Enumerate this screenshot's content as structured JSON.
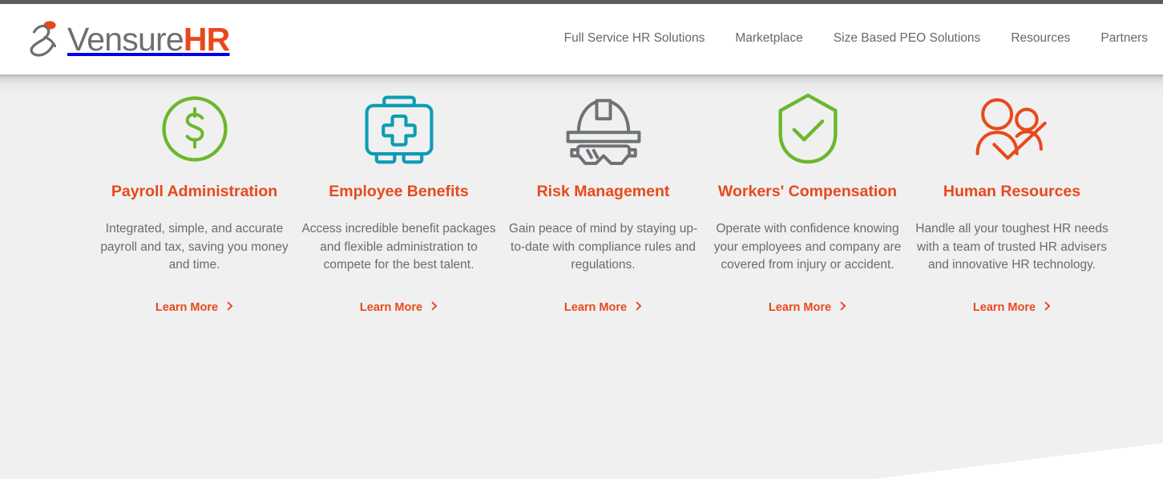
{
  "theme": {
    "orange": "#e8491c",
    "green": "#6cb72e",
    "teal": "#0d9cb5",
    "gray_icon": "#6e7275",
    "text_gray": "#6b6b70",
    "panel_bg": "#f0f0f0",
    "top_strip": "#5b5b60"
  },
  "header": {
    "logo": {
      "mark": "vensure-runner-icon",
      "text_primary": "Vensure",
      "text_accent": "HR"
    },
    "nav": [
      {
        "label": "Full Service HR Solutions",
        "name": "nav-full-service-hr-solutions"
      },
      {
        "label": "Marketplace",
        "name": "nav-marketplace"
      },
      {
        "label": "Size Based PEO Solutions",
        "name": "nav-size-based-peo-solutions"
      },
      {
        "label": "Resources",
        "name": "nav-resources"
      },
      {
        "label": "Partners",
        "name": "nav-partners"
      }
    ]
  },
  "cards": [
    {
      "icon": "dollar-circle-icon",
      "icon_color": "#6cb72e",
      "title": "Payroll Administration",
      "description": "Integrated, simple, and accurate payroll and tax, saving you money and time.",
      "link_label": "Learn More"
    },
    {
      "icon": "first-aid-kit-icon",
      "icon_color": "#0d9cb5",
      "title": "Employee Benefits",
      "description": "Access incredible benefit packages and flexible administration to compete for the best talent.",
      "link_label": "Learn More"
    },
    {
      "icon": "hardhat-goggles-icon",
      "icon_color": "#6e7275",
      "title": "Risk Management",
      "description": "Gain peace of mind by staying up-to-date with compliance rules and regulations.",
      "link_label": "Learn More"
    },
    {
      "icon": "shield-check-icon",
      "icon_color": "#6cb72e",
      "title": "Workers' Compensation",
      "description": "Operate with confidence knowing your employees and company are covered from injury or accident.",
      "link_label": "Learn More"
    },
    {
      "icon": "people-check-icon",
      "icon_color": "#e8491c",
      "title": "Human Resources",
      "description": "Handle all your toughest HR needs with a team of trusted HR advisers and innovative HR technology.",
      "link_label": "Learn More"
    }
  ]
}
